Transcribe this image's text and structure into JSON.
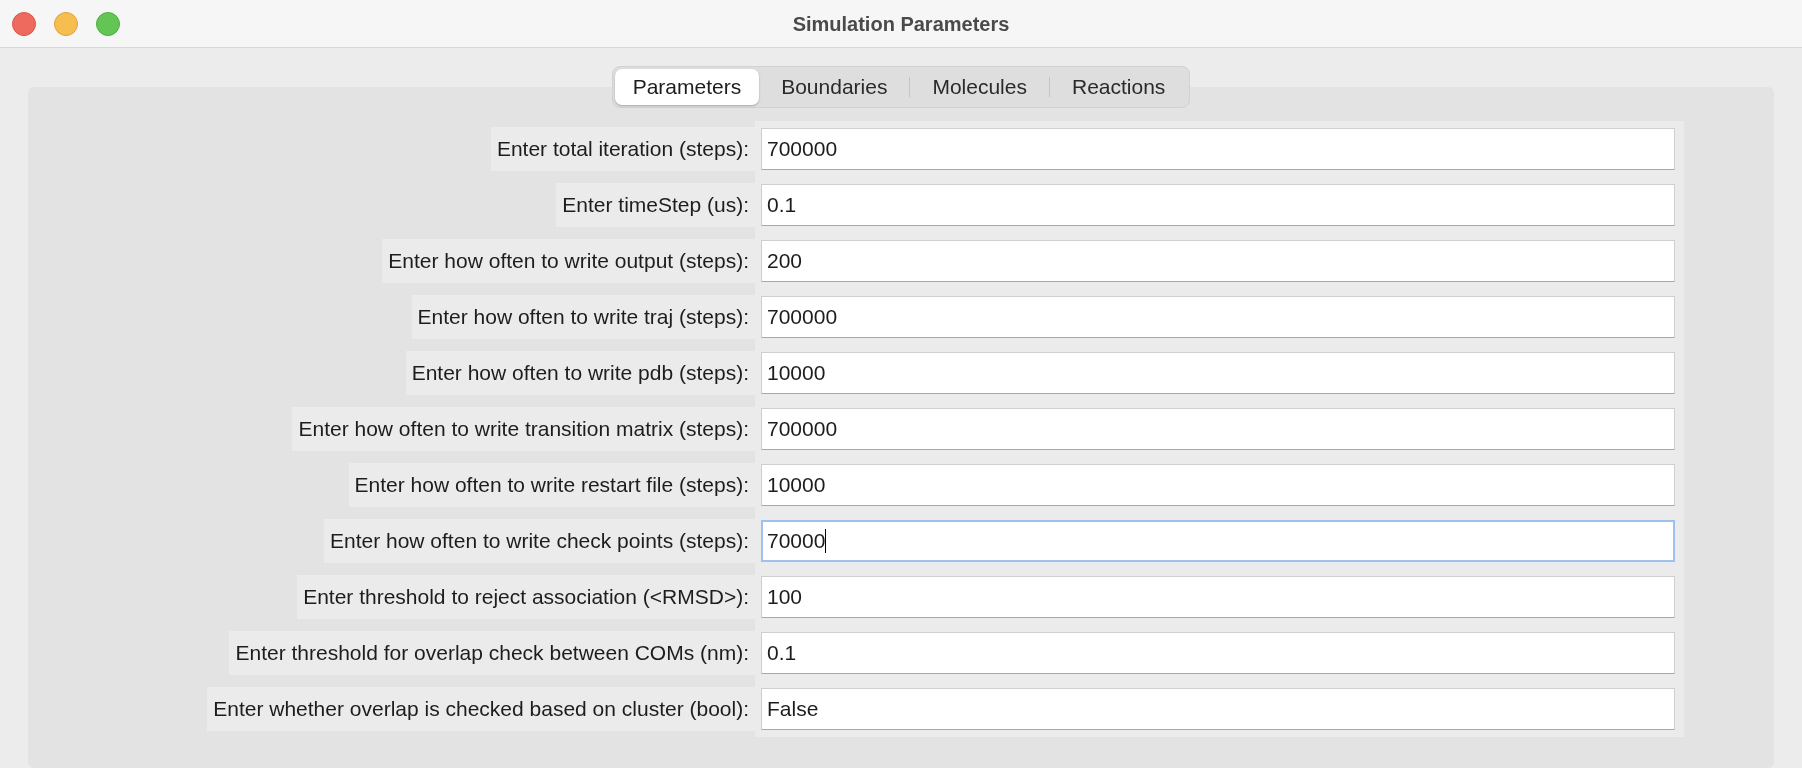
{
  "window": {
    "title": "Simulation Parameters"
  },
  "tabs": [
    {
      "label": "Parameters",
      "selected": true
    },
    {
      "label": "Boundaries",
      "selected": false
    },
    {
      "label": "Molecules",
      "selected": false
    },
    {
      "label": "Reactions",
      "selected": false
    }
  ],
  "fields": [
    {
      "label": "Enter total iteration (steps):",
      "value": "700000",
      "focused": false
    },
    {
      "label": "Enter timeStep (us):",
      "value": "0.1",
      "focused": false
    },
    {
      "label": "Enter how often to write output (steps):",
      "value": "200",
      "focused": false
    },
    {
      "label": "Enter how often to write traj (steps):",
      "value": "700000",
      "focused": false
    },
    {
      "label": "Enter how often to write pdb (steps):",
      "value": "10000",
      "focused": false
    },
    {
      "label": "Enter how often to write transition matrix (steps):",
      "value": "700000",
      "focused": false
    },
    {
      "label": "Enter how often to write restart file (steps):",
      "value": "10000",
      "focused": false
    },
    {
      "label": "Enter how often to write check points (steps):",
      "value": "70000",
      "focused": true
    },
    {
      "label": "Enter threshold to reject association (<RMSD>):",
      "value": "100",
      "focused": false
    },
    {
      "label": "Enter threshold for overlap check between COMs (nm):",
      "value": "0.1",
      "focused": false
    },
    {
      "label": "Enter whether overlap is checked based on cluster (bool):",
      "value": "False",
      "focused": false
    }
  ]
}
